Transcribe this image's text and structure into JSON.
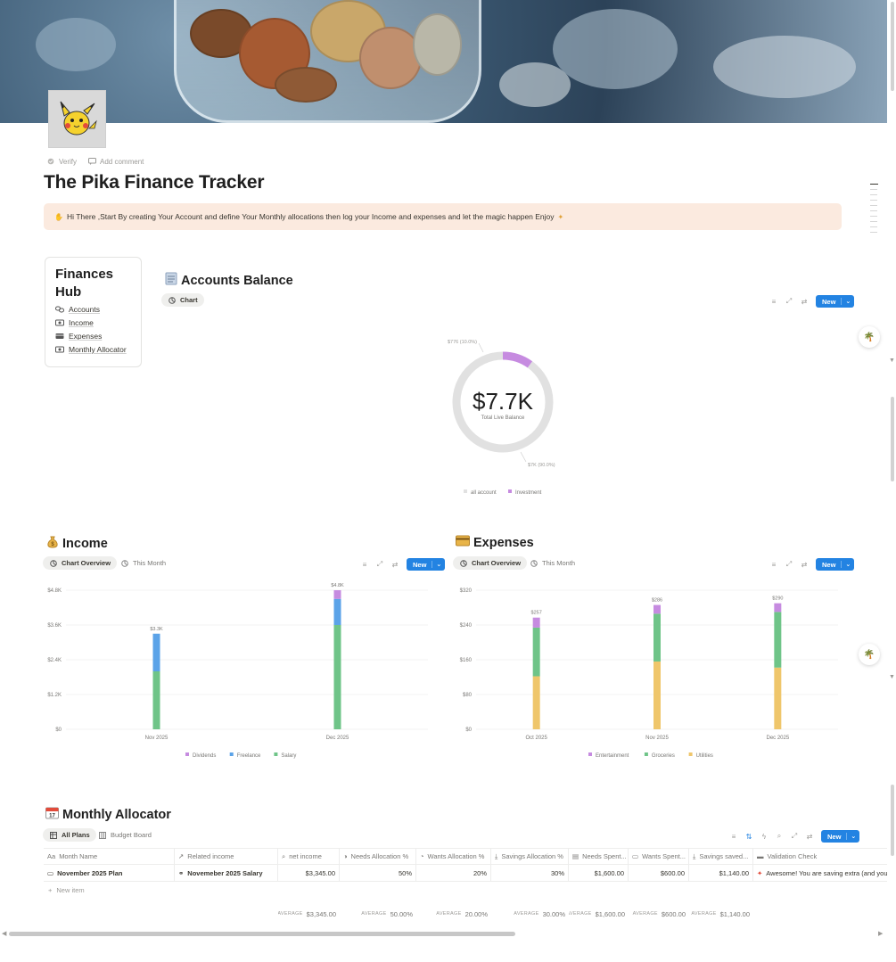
{
  "page": {
    "title": "The Pika Finance Tracker",
    "verify_label": "Verify",
    "comment_label": "Add comment"
  },
  "callout": {
    "text": "Hi There ,Start By creating Your Account and define Your Monthly allocations then log your Income and expenses and let the magic happen Enjoy"
  },
  "hub": {
    "title": "Finances Hub",
    "items": [
      {
        "label": "Accounts",
        "icon": "link-icon"
      },
      {
        "label": "Income",
        "icon": "cash-icon"
      },
      {
        "label": "Expenses",
        "icon": "card-icon"
      },
      {
        "label": "Monthly Allocator",
        "icon": "cash-icon"
      }
    ]
  },
  "accounts": {
    "title": "Accounts Balance",
    "view_chip": "Chart",
    "new_label": "New"
  },
  "income": {
    "title": "Income",
    "tab_active": "Chart Overview",
    "tab_other": "This Month",
    "new_label": "New"
  },
  "expenses": {
    "title": "Expenses",
    "tab_active": "Chart Overview",
    "tab_other": "This Month",
    "new_label": "New"
  },
  "allocator": {
    "title": "Monthly Allocator",
    "tab_active": "All Plans",
    "tab_other": "Budget Board",
    "new_label": "New",
    "columns": [
      "Month Name",
      "Related income",
      "net income",
      "Needs Allocation %",
      "Wants Allocation %",
      "Savings Allocation %",
      "Needs Spent...",
      "Wants Spent...",
      "Savings saved...",
      "Validation Check"
    ],
    "rows": [
      {
        "month": "November 2025 Plan",
        "related": "Novemeber 2025 Salary",
        "net_income": "$3,345.00",
        "needs_pct": "50%",
        "wants_pct": "20%",
        "savings_pct": "30%",
        "needs_spent": "$1,600.00",
        "wants_spent": "$600.00",
        "savings_saved": "$1,140.00",
        "validation": "Awesome! You are saving extra (and you c"
      }
    ],
    "new_item_label": "New item",
    "average_label": "AVERAGE",
    "averages": {
      "net_income": "$3,345.00",
      "needs_pct": "50.00%",
      "wants_pct": "20.00%",
      "savings_pct": "30.00%",
      "needs_spent": "$1,600.00",
      "wants_spent": "$600.00",
      "savings_saved": "$1,140.00"
    }
  },
  "colors": {
    "accent": "#2383e2",
    "callout_bg": "#fbeadf",
    "purple": "#c68be0",
    "blue": "#5ba3e8",
    "green": "#6fc488",
    "yellow": "#efc66b",
    "grey_ring": "#e1e1e1"
  },
  "chart_data": [
    {
      "type": "pie",
      "title": "",
      "center_value": "$7.7K",
      "center_label": "Total Live Balance",
      "slices": [
        {
          "name": "all account",
          "value": 7000,
          "label": "$7K (90.0%)",
          "color": "#e1e1e1"
        },
        {
          "name": "Investment",
          "value": 776,
          "label": "$776 (10.0%)",
          "color": "#c68be0"
        }
      ],
      "legend": "bottom"
    },
    {
      "type": "bar",
      "stacked": true,
      "title": "",
      "categories": [
        "Nov 2025",
        "Dec 2025"
      ],
      "series": [
        {
          "name": "Salary",
          "values": [
            2000,
            3600
          ],
          "color": "#6fc488"
        },
        {
          "name": "Freelance",
          "values": [
            1300,
            900
          ],
          "color": "#5ba3e8"
        },
        {
          "name": "Dividends",
          "values": [
            0,
            300
          ],
          "color": "#c68be0"
        }
      ],
      "totals": [
        "$3.3K",
        "$4.8K"
      ],
      "yticks": [
        "$0",
        "$1.2K",
        "$2.4K",
        "$3.6K",
        "$4.8K"
      ],
      "ylim": [
        0,
        4800
      ],
      "grid": true,
      "legend": "bottom"
    },
    {
      "type": "bar",
      "stacked": true,
      "title": "",
      "categories": [
        "Oct 2025",
        "Nov 2025",
        "Dec 2025"
      ],
      "series": [
        {
          "name": "Utilities",
          "values": [
            122,
            156,
            142
          ],
          "color": "#efc66b"
        },
        {
          "name": "Groceries",
          "values": [
            112,
            110,
            128
          ],
          "color": "#6fc488"
        },
        {
          "name": "Entertainment",
          "values": [
            23,
            20,
            20
          ],
          "color": "#c68be0"
        }
      ],
      "totals": [
        "$257",
        "$286",
        "$290"
      ],
      "yticks": [
        "$0",
        "$80",
        "$160",
        "$240",
        "$320"
      ],
      "ylim": [
        0,
        320
      ],
      "grid": true,
      "legend": "bottom"
    }
  ]
}
